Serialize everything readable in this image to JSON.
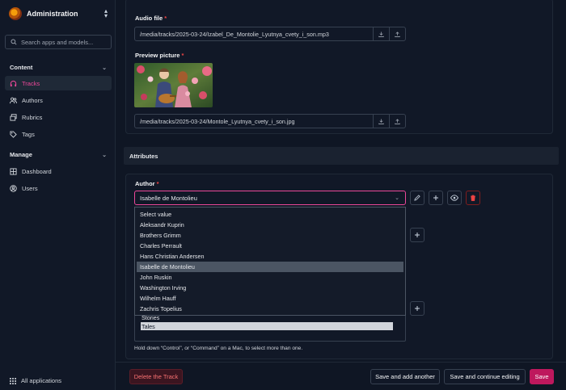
{
  "app": {
    "title": "Administration"
  },
  "search": {
    "placeholder": "Search apps and models..."
  },
  "sidebar": {
    "sections": [
      {
        "label": "Content",
        "items": [
          {
            "label": "Tracks",
            "icon": "headphones-icon"
          },
          {
            "label": "Authors",
            "icon": "users-icon"
          },
          {
            "label": "Rubrics",
            "icon": "stack-icon"
          },
          {
            "label": "Tags",
            "icon": "tag-icon"
          }
        ]
      },
      {
        "label": "Manage",
        "items": [
          {
            "label": "Dashboard",
            "icon": "grid-icon"
          },
          {
            "label": "Users",
            "icon": "user-circle-icon"
          }
        ]
      }
    ],
    "all_apps": "All applications"
  },
  "form": {
    "audio_label": "Audio file",
    "audio_path": "/media/tracks/2025-03-24/Izabel_De_Montolie_Lyutnya_cvety_i_son.mp3",
    "preview_label": "Preview picture",
    "preview_path": "/media/tracks/2025-03-24/Montole_Lyutnya_cvety_i_son.jpg",
    "attributes_heading": "Attributes",
    "author_label": "Author",
    "author_value": "Isabelle de Montolieu",
    "author_options": [
      "Select value",
      "Aleksandr Kuprin",
      "Brothers Grimm",
      "Charles Perrault",
      "Hans Christian Andersen",
      "Isabelle de Montolieu",
      "John Ruskin",
      "Washington Irving",
      "Wilhelm Hauff",
      "Zachris Topelius"
    ],
    "multiselect_options": [
      "Stories",
      "Tales"
    ],
    "multiselect_help": "Hold down “Control”, or “Command” on a Mac, to select more than one.",
    "required_mark": "*"
  },
  "footer": {
    "delete_label": "Delete the Track",
    "save_add_label": "Save and add another",
    "save_continue_label": "Save and continue editing",
    "save_label": "Save"
  },
  "colors": {
    "accent": "#be185d",
    "active_nav": "#ec4899",
    "danger": "#ef4444"
  }
}
